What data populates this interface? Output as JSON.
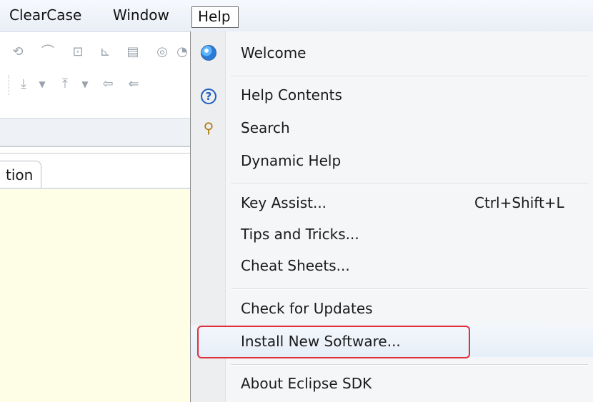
{
  "menubar": {
    "clearcase": "ClearCase",
    "window": "Window",
    "help": "Help"
  },
  "workbench": {
    "tab_label": "tion"
  },
  "help_menu": {
    "items": [
      {
        "label": "Welcome",
        "icon": "welcome-icon"
      },
      {
        "label": "Help Contents",
        "icon": "help-contents-icon"
      },
      {
        "label": "Search",
        "icon": "search-icon"
      },
      {
        "label": "Dynamic Help",
        "icon": ""
      },
      {
        "label": "Key Assist...",
        "accelerator": "Ctrl+Shift+L"
      },
      {
        "label": "Tips and Tricks..."
      },
      {
        "label": "Cheat Sheets..."
      },
      {
        "label": "Check for Updates"
      },
      {
        "label": "Install New Software..."
      },
      {
        "label": "About Eclipse SDK"
      }
    ]
  },
  "colors": {
    "highlight_box": "#e0303a",
    "editor_background": "#fefee6"
  }
}
